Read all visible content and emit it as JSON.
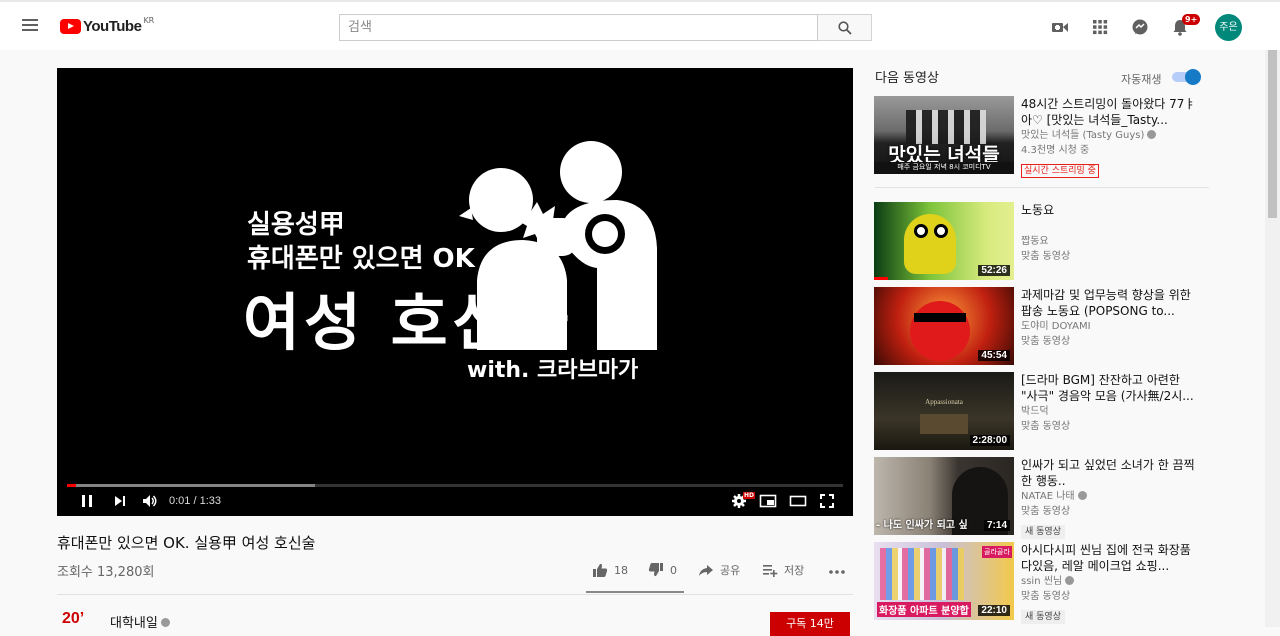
{
  "header": {
    "logo_text": "YouTube",
    "logo_country": "KR",
    "search_placeholder": "검색",
    "notification_count": "9+",
    "avatar_text": "주은"
  },
  "player": {
    "overlay_line1": "실용성甲",
    "overlay_line2": "휴대폰만 있으면 OK",
    "overlay_line3": "여성 호신술",
    "overlay_line4": "with. 크라브마가",
    "time_display": "0:01 / 1:33",
    "hd_badge": "HD",
    "progress_played": 0.011,
    "progress_buffered": 0.32
  },
  "video": {
    "title": "휴대폰만 있으면 OK. 실용甲 여성 호신술",
    "views": "조회수 13,280회",
    "likes": "18",
    "dislikes": "0",
    "share_label": "공유",
    "save_label": "저장"
  },
  "channel": {
    "logo_text": "20’",
    "name": "대학내일",
    "subscribe_label": "구독 14만"
  },
  "sidebar": {
    "up_next_label": "다음 동영상",
    "autoplay_label": "자동재생",
    "autoplay_on": true,
    "items": [
      {
        "title": "48시간 스트리밍이 돌아왔다 77ㅑ아♡ [맛있는 녀석들_Tasty...",
        "channel": "맛있는 녀석들 (Tasty Guys)",
        "meta": "4.3천명 시청 중",
        "badge": "실시간 스트리밍 중",
        "thumb_text": "맛있는 녀석들",
        "thumb_sub": "매주 금요일 저녁 8시 코미디TV"
      },
      {
        "title": "노동요",
        "channel": "짭동요",
        "meta": "맞춤 동영상",
        "duration": "52:26"
      },
      {
        "title": "과제마감 및 업무능력 향상을 위한 팝송 노동요 (POPSONG to...",
        "channel": "도야미 DOYAMI",
        "meta": "맞춤 동영상",
        "duration": "45:54"
      },
      {
        "title": "[드라마 BGM] 잔잔하고 아련한 \"사극\" 경음악 모음 (가사無/2시...",
        "channel": "박드덕",
        "meta": "맞춤 동영상",
        "duration": "2:28:00",
        "thumb_text": "Appassionata"
      },
      {
        "title": "인싸가 되고 싶었던 소녀가 한 끔찍한 행동..",
        "channel": "NATAE 나태",
        "meta": "맞춤 동영상",
        "badge": "새 동영상",
        "duration": "7:14",
        "thumb_text": "- 나도 인싸가 되고 싶"
      },
      {
        "title": "아시다시피 씬님 집에 전국 화장품 다있음, 레알 메이크업 쇼핑...",
        "channel": "ssin 씬님",
        "meta": "맞춤 동영상",
        "badge": "새 동영상",
        "duration": "22:10",
        "thumb_text": "화장품 아파트 분양합",
        "thumb_tag": "골라골라"
      }
    ]
  },
  "colors": {
    "brand_red": "#ff0000",
    "subscribe_red": "#cc0000",
    "autoplay_blue": "#167ac6",
    "avatar_green": "#00897b"
  }
}
